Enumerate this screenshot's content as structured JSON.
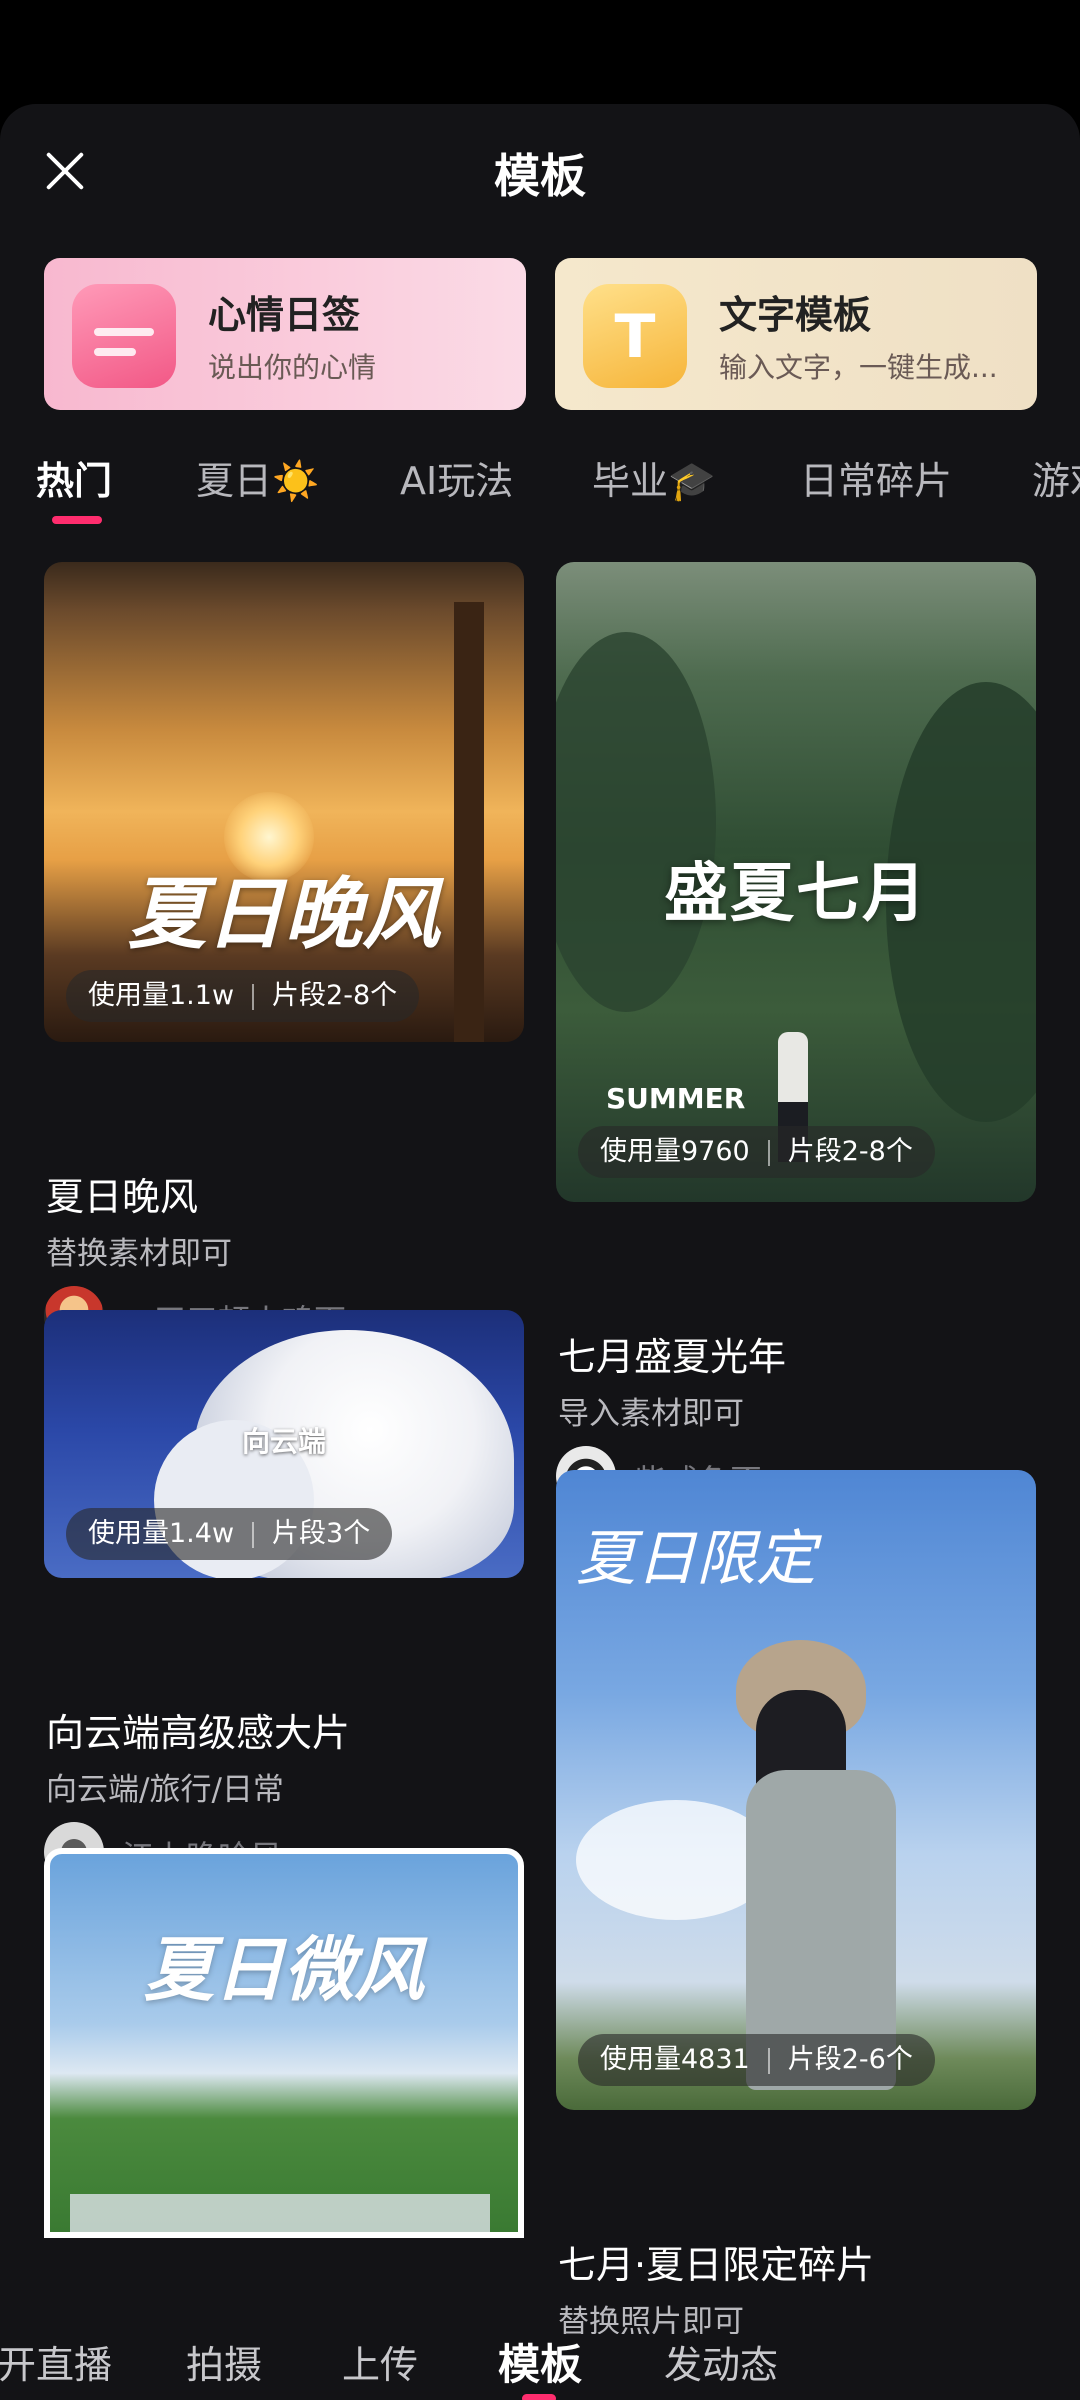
{
  "header": {
    "title": "模板",
    "close_icon": "close-icon"
  },
  "promos": [
    {
      "title": "心情日签",
      "subtitle": "说出你的心情",
      "icon": "mood-calendar-icon",
      "accent": "#f25886"
    },
    {
      "title": "文字模板",
      "subtitle": "输入文字，一键生成...",
      "icon": "text-t-icon",
      "accent": "#f6b53a",
      "icon_glyph": "T"
    }
  ],
  "tabs": [
    "热门",
    "夏日☀️",
    "AI玩法",
    "毕业🎓",
    "日常碎片",
    "游戏"
  ],
  "active_tab": "热门",
  "accent_color": "#ff2d6e",
  "cards": [
    {
      "title": "夏日晚风",
      "subtitle": "替换素材即可",
      "usage": "使用量1.1w",
      "segments": "片段2-8个",
      "author": "一天三顿火鸡面",
      "thumb_text": "夏日晚风"
    },
    {
      "title": "七月盛夏光年",
      "subtitle": "导入素材即可",
      "usage": "使用量9760",
      "segments": "片段2-8个",
      "author": "柴咸鱼否",
      "thumb_text": "盛夏七月",
      "thumb_sub": "SUMMER"
    },
    {
      "title": "向云端高级感大片",
      "subtitle": "向云端/旅行/日常",
      "usage": "使用量1.4w",
      "segments": "片段3个",
      "author": "江上晚吟风--",
      "thumb_text": "向云端"
    },
    {
      "title": "七月·夏日限定碎片",
      "subtitle": "替换照片即可",
      "usage": "使用量4831",
      "segments": "片段2-6个",
      "thumb_text": "夏日限定"
    },
    {
      "thumb_text": "夏日微风"
    }
  ],
  "bottom_nav": [
    "开直播",
    "拍摄",
    "上传",
    "模板",
    "发动态"
  ],
  "active_nav": "模板"
}
